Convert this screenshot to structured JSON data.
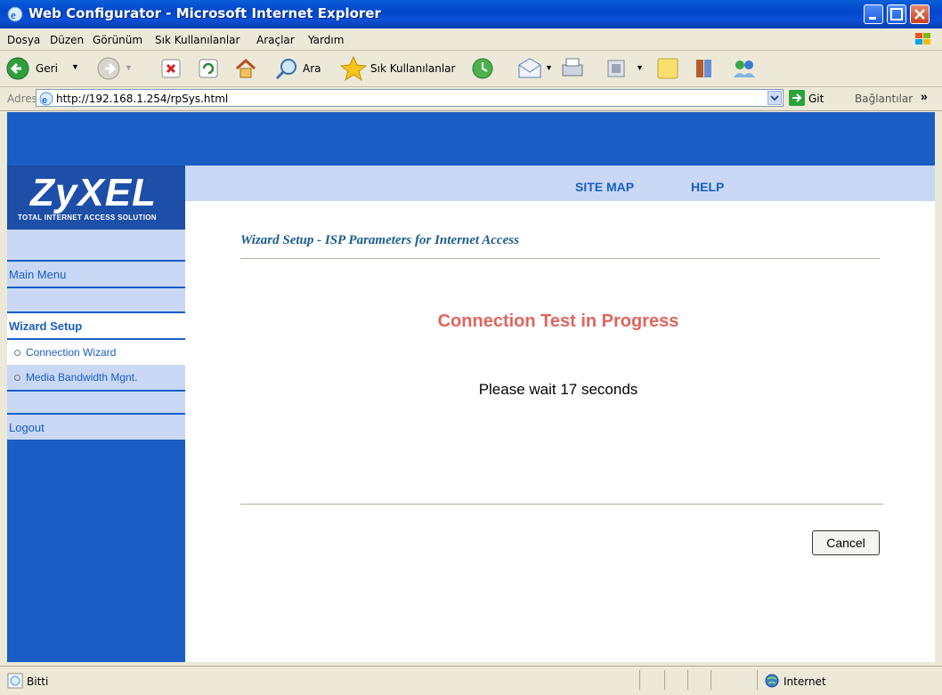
{
  "window": {
    "title": "Web Configurator - Microsoft Internet Explorer"
  },
  "menu": {
    "items": [
      "Dosya",
      "Düzen",
      "Görünüm",
      "Sık Kullanılanlar",
      "Araçlar",
      "Yardım"
    ]
  },
  "toolbar": {
    "back": "Geri",
    "search": "Ara",
    "favorites": "Sık Kullanılanlar"
  },
  "address": {
    "label": "Adres",
    "url": "http://192.168.1.254/rpSys.html",
    "go": "Git",
    "links": "Bağlantılar"
  },
  "brand": {
    "logo": "ZyXEL",
    "tagline": "TOTAL INTERNET ACCESS SOLUTION"
  },
  "topnav": {
    "site_map": "SITE MAP",
    "help": "HELP"
  },
  "sidebar": {
    "main_menu": "Main Menu",
    "wizard_setup": "Wizard Setup",
    "items": [
      "Connection Wizard",
      "Media Bandwidth Mgnt."
    ],
    "logout": "Logout"
  },
  "main": {
    "title": "Wizard Setup - ISP Parameters for Internet Access",
    "heading": "Connection Test in Progress",
    "message": "Please wait 17 seconds",
    "cancel": "Cancel"
  },
  "status": {
    "text": "Bitti",
    "zone": "Internet"
  },
  "colors": {
    "brand_blue": "#1a5dc5",
    "light_blue": "#c8d8f5",
    "heading_red": "#e0655e"
  }
}
